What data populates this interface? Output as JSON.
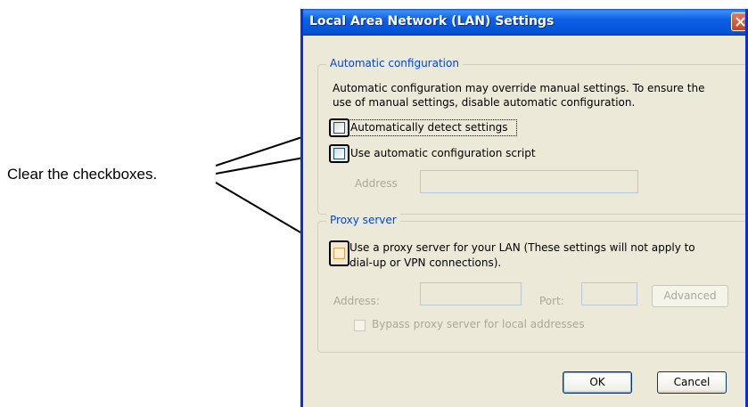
{
  "annotation": {
    "text": "Clear the checkboxes."
  },
  "dialog": {
    "title": "Local Area Network (LAN) Settings",
    "automatic_configuration": {
      "legend": "Automatic configuration",
      "description_line1": "Automatic configuration may override manual settings.  To ensure the",
      "description_line2": "use of manual settings, disable automatic configuration.",
      "auto_detect": {
        "label": "Automatically detect settings",
        "checked": false
      },
      "auto_script": {
        "label": "Use automatic configuration script",
        "checked": false
      },
      "address_label": "Address",
      "address_value": ""
    },
    "proxy_server": {
      "legend": "Proxy server",
      "use_proxy": {
        "label_line1": "Use a proxy server for your LAN (These settings will not apply to",
        "label_line2": "dial-up or VPN connections).",
        "checked": false
      },
      "address_label": "Address:",
      "address_value": "",
      "port_label": "Port:",
      "port_value": "",
      "advanced_button": "Advanced",
      "bypass": {
        "label": "Bypass proxy server for local addresses",
        "checked": false
      }
    },
    "ok_button": "OK",
    "cancel_button": "Cancel"
  },
  "colors": {
    "title_bar": "#0553d6",
    "dialog_background": "#ece9d8",
    "group_legend": "#0046d5",
    "disabled_text": "#aca899"
  }
}
